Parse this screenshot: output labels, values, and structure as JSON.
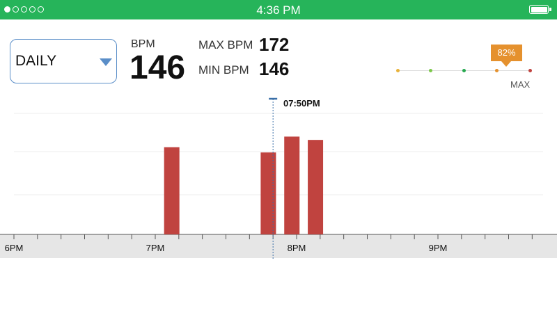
{
  "status_bar": {
    "time": "4:36 PM",
    "signal": [
      true,
      false,
      false,
      false,
      false
    ],
    "battery": 1.0
  },
  "range_select": {
    "value": "DAILY",
    "icon": "caret-down-icon"
  },
  "stats": {
    "bpm_label": "BPM",
    "bpm_value": "146",
    "max_label": "MAX BPM",
    "max_value": "172",
    "min_label": "MIN BPM",
    "min_value": "146"
  },
  "zone_indicator": {
    "percent_label": "82%",
    "percent": 82,
    "max_label": "MAX",
    "zones": [
      {
        "color": "#e8b23a"
      },
      {
        "color": "#7cc84a"
      },
      {
        "color": "#26a84f"
      },
      {
        "color": "#e5912e"
      },
      {
        "color": "#c0433f"
      }
    ]
  },
  "colors": {
    "status_bar": "#26b45a",
    "bar": "#c0433f",
    "accent": "#5a8ec8",
    "cursor": "#3a6fa8"
  },
  "chart_data": {
    "type": "bar",
    "x_ticks": [
      "6PM",
      "7PM",
      "8PM",
      "9PM"
    ],
    "cursor_time": "07:50PM",
    "cursor_at": "19:50",
    "bars": [
      {
        "time": "19:07",
        "relative_height": 0.66
      },
      {
        "time": "19:48",
        "relative_height": 0.62
      },
      {
        "time": "19:58",
        "relative_height": 0.74
      },
      {
        "time": "20:08",
        "relative_height": 0.715
      }
    ]
  }
}
